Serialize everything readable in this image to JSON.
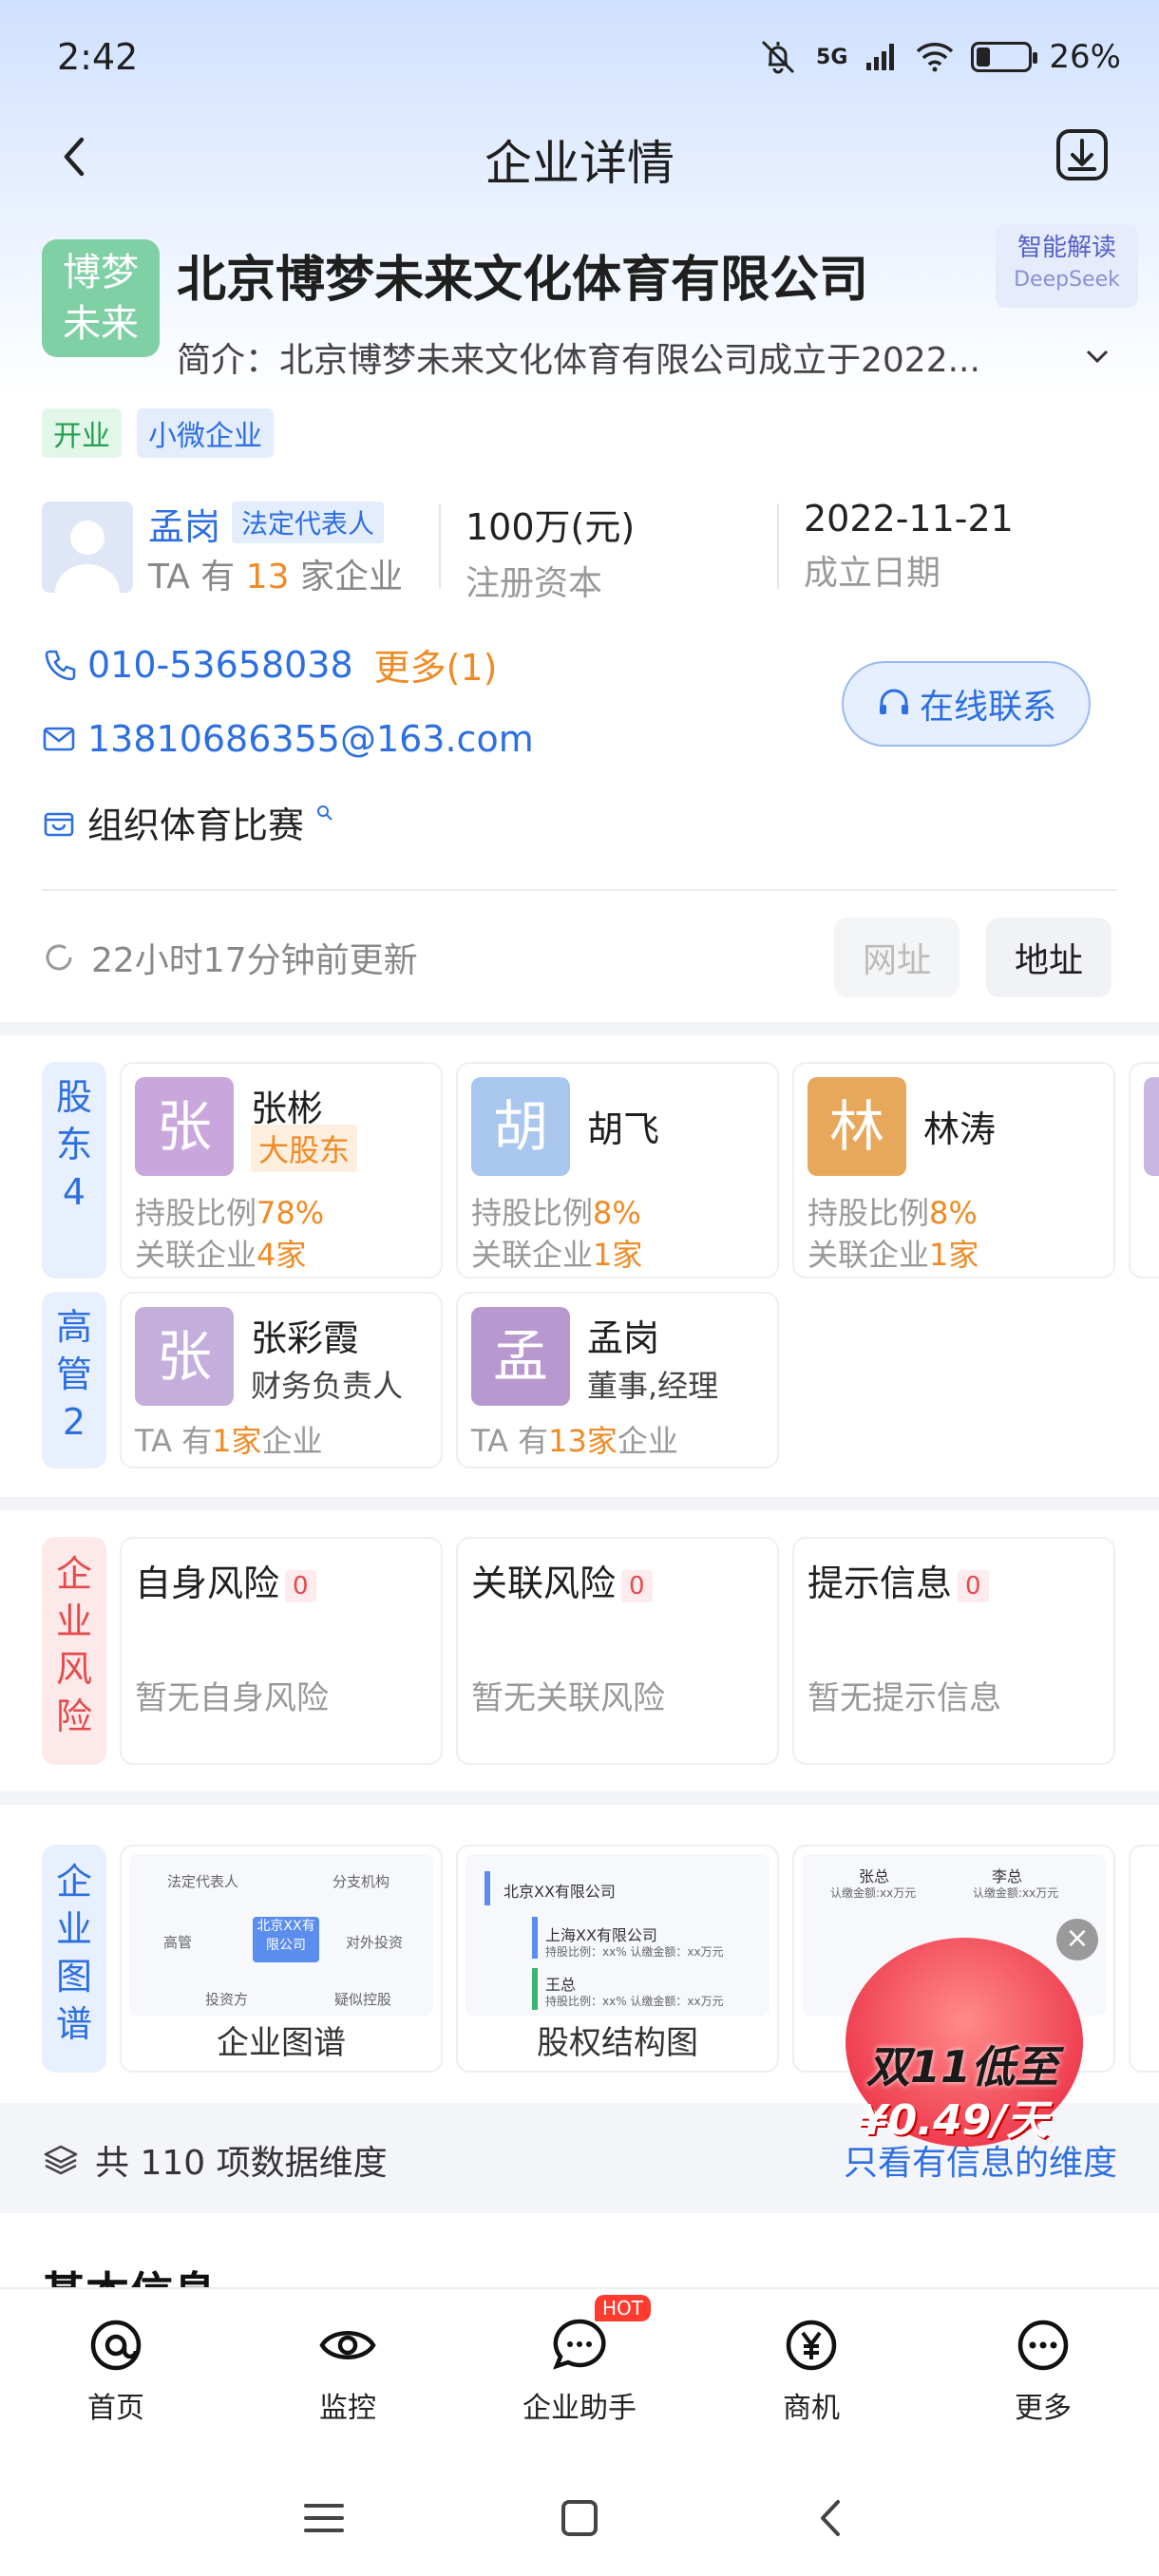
{
  "status_bar": {
    "time": "2:42",
    "network": "5G",
    "battery": "26%"
  },
  "nav": {
    "title": "企业详情"
  },
  "company": {
    "logo_line1": "博梦",
    "logo_line2": "未来",
    "name": "北京博梦未来文化体育有限公司",
    "intro": "简介：北京博梦未来文化体育有限公司成立于2022...",
    "ai_badge": {
      "title": "智能解读",
      "sub": "DeepSeek"
    },
    "tags": [
      "开业",
      "小微企业"
    ]
  },
  "representative": {
    "name": "孟岗",
    "role": "法定代表人",
    "count_prefix": "TA 有",
    "count": "13",
    "count_suffix": "家企业",
    "capital_value": "100万(元)",
    "capital_label": "注册资本",
    "date_value": "2022-11-21",
    "date_label": "成立日期"
  },
  "contacts": {
    "phone": "010-53658038",
    "phone_more": "更多(1)",
    "email": "13810686355@163.com",
    "business": "组织体育比赛",
    "online_button": "在线联系"
  },
  "update": {
    "text": "22小时17分钟前更新",
    "website_button": "网址",
    "address_button": "地址"
  },
  "shareholders": {
    "label": "股东",
    "count": "4",
    "items": [
      {
        "avatar": "张",
        "name": "张彬",
        "badge": "大股东",
        "ratio_label": "持股比例",
        "ratio": "78%",
        "related_label": "关联企业",
        "related": "4家",
        "color": "#c9a7dd"
      },
      {
        "avatar": "胡",
        "name": "胡飞",
        "ratio_label": "持股比例",
        "ratio": "8%",
        "related_label": "关联企业",
        "related": "1家",
        "color": "#a9c6ef"
      },
      {
        "avatar": "林",
        "name": "林涛",
        "ratio_label": "持股比例",
        "ratio": "8%",
        "related_label": "关联企业",
        "related": "1家",
        "color": "#e8a85b"
      }
    ]
  },
  "executives": {
    "label": "高管",
    "count": "2",
    "items": [
      {
        "avatar": "张",
        "name": "张彩霞",
        "position": "财务负责人",
        "prefix": "TA 有",
        "count": "1家",
        "suffix": "企业",
        "color": "#c4aedc"
      },
      {
        "avatar": "孟",
        "name": "孟岗",
        "position": "董事,经理",
        "prefix": "TA 有",
        "count": "13家",
        "suffix": "企业",
        "color": "#b799cf"
      }
    ]
  },
  "risk": {
    "label": "企业风险",
    "items": [
      {
        "title": "自身风险",
        "count": "0",
        "desc": "暂无自身风险"
      },
      {
        "title": "关联风险",
        "count": "0",
        "desc": "暂无关联风险"
      },
      {
        "title": "提示信息",
        "count": "0",
        "desc": "暂无提示信息"
      }
    ]
  },
  "graph": {
    "label": "企业图谱",
    "items": [
      "企业图谱",
      "股权结构图"
    ],
    "mini1": {
      "center": "北京XX有限公司",
      "n1": "法定代表人",
      "n2": "分支机构",
      "n3": "高管",
      "n4": "对外投资",
      "n5": "投资方",
      "n6": "疑似控股"
    },
    "mini2": {
      "r1": "北京XX有限公司",
      "r2": "上海XX有限公司",
      "r3": "王总",
      "meta": "持股比例：xx%   认缴金额：xx万元"
    },
    "mini3": {
      "a": "张总",
      "b": "李总",
      "meta": "认缴金额:xx万元"
    }
  },
  "dimensions": {
    "text": "共 110 项数据维度",
    "link": "只看有信息的维度"
  },
  "basic_title": "基本信息",
  "ad": {
    "line1": "双11低至",
    "line2": "¥0.49/天"
  },
  "tabbar": [
    {
      "label": "首页",
      "icon": "home-at-icon"
    },
    {
      "label": "监控",
      "icon": "eye-icon"
    },
    {
      "label": "企业助手",
      "icon": "chat-icon",
      "badge": "HOT"
    },
    {
      "label": "商机",
      "icon": "yuan-icon"
    },
    {
      "label": "更多",
      "icon": "more-icon"
    }
  ],
  "colors": {
    "accent": "#2d6fe0",
    "orange": "#f08a24",
    "red": "#e54a4a",
    "green": "#22a14d"
  }
}
